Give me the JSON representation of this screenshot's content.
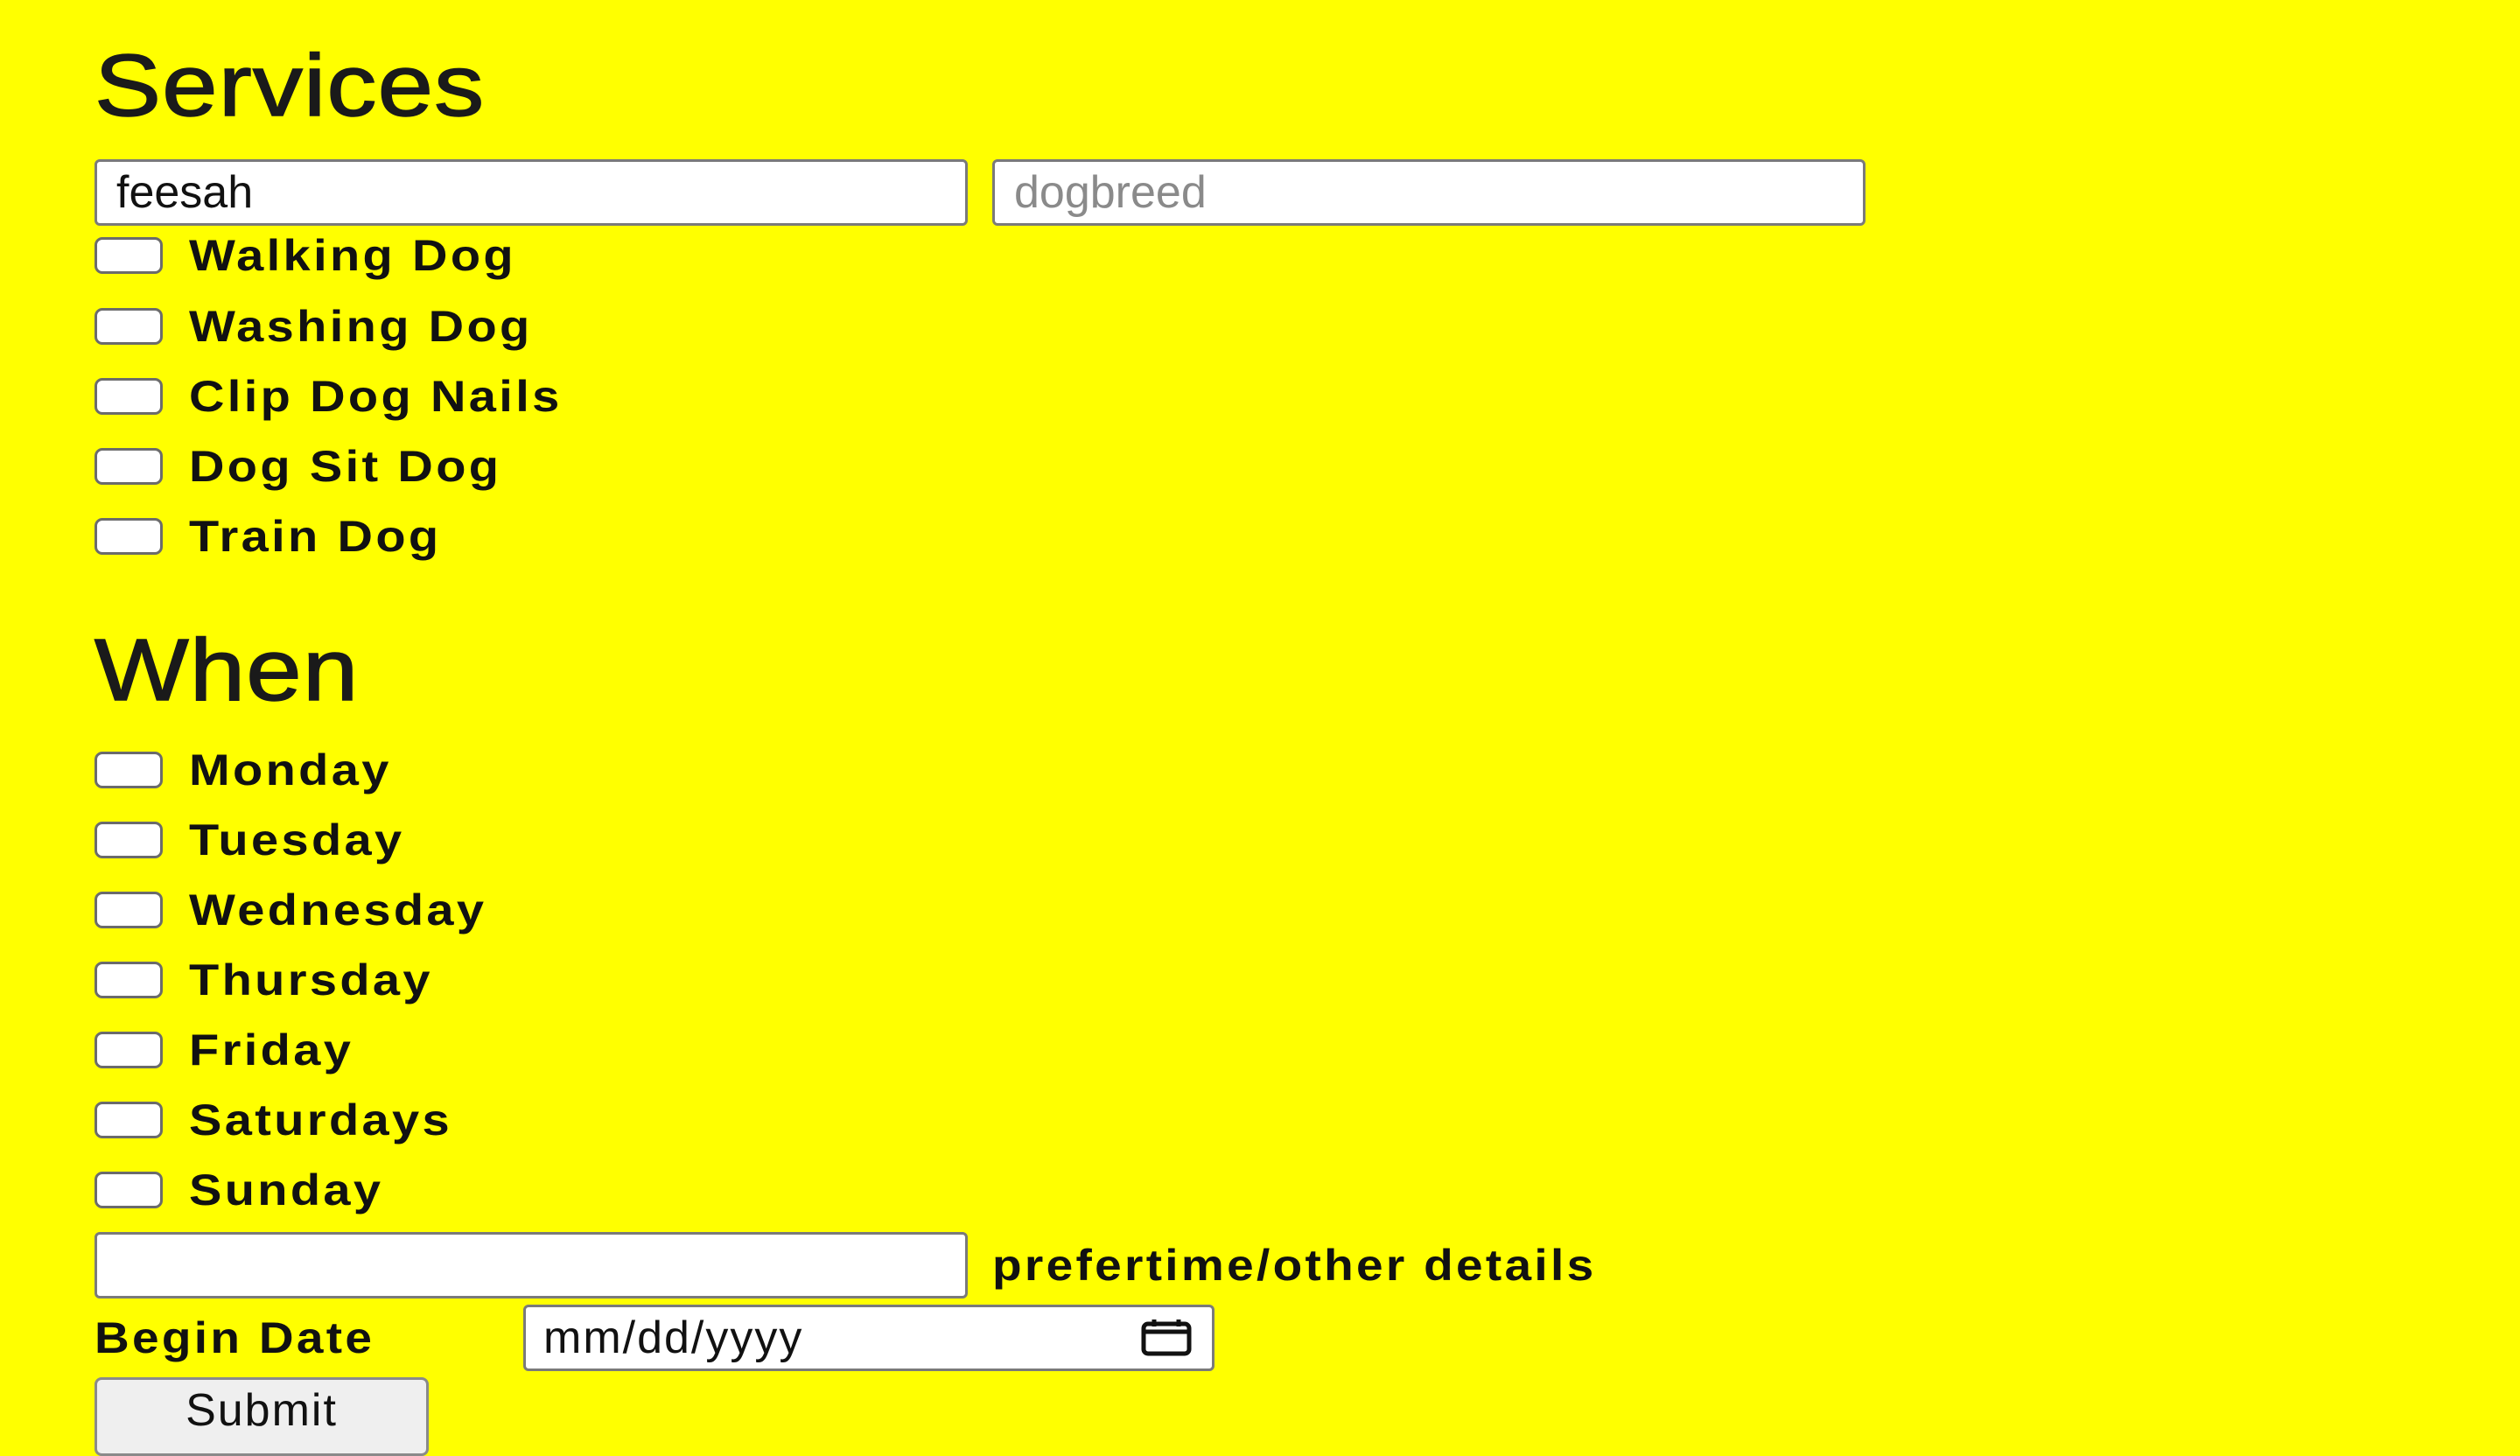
{
  "services": {
    "heading": "Services",
    "name_field": {
      "value": "feesah",
      "placeholder": ""
    },
    "breed_field": {
      "value": "",
      "placeholder": "dogbreed"
    },
    "options": [
      {
        "label": "Walking Dog",
        "checked": false
      },
      {
        "label": "Washing Dog",
        "checked": false
      },
      {
        "label": "Clip Dog Nails",
        "checked": false
      },
      {
        "label": "Dog Sit Dog",
        "checked": false
      },
      {
        "label": "Train Dog",
        "checked": false
      }
    ]
  },
  "when": {
    "heading": "When",
    "days": [
      {
        "label": "Monday",
        "checked": false
      },
      {
        "label": "Tuesday",
        "checked": false
      },
      {
        "label": "Wednesday",
        "checked": false
      },
      {
        "label": "Thursday",
        "checked": false
      },
      {
        "label": "Friday",
        "checked": false
      },
      {
        "label": "Saturdays",
        "checked": false
      },
      {
        "label": "Sunday",
        "checked": false
      }
    ],
    "details_field": {
      "value": ""
    },
    "details_label": "prefertime/other details",
    "begin_date_label": "Begin Date",
    "begin_date_placeholder": "mm/dd/yyyy",
    "submit_label": "Submit"
  },
  "icons": {
    "calendar": "calendar-icon"
  },
  "colors": {
    "background": "#ffff00",
    "text": "#111111",
    "input_border": "#7a7a7a",
    "placeholder": "#8a8a8a",
    "button_bg": "#efefef"
  }
}
